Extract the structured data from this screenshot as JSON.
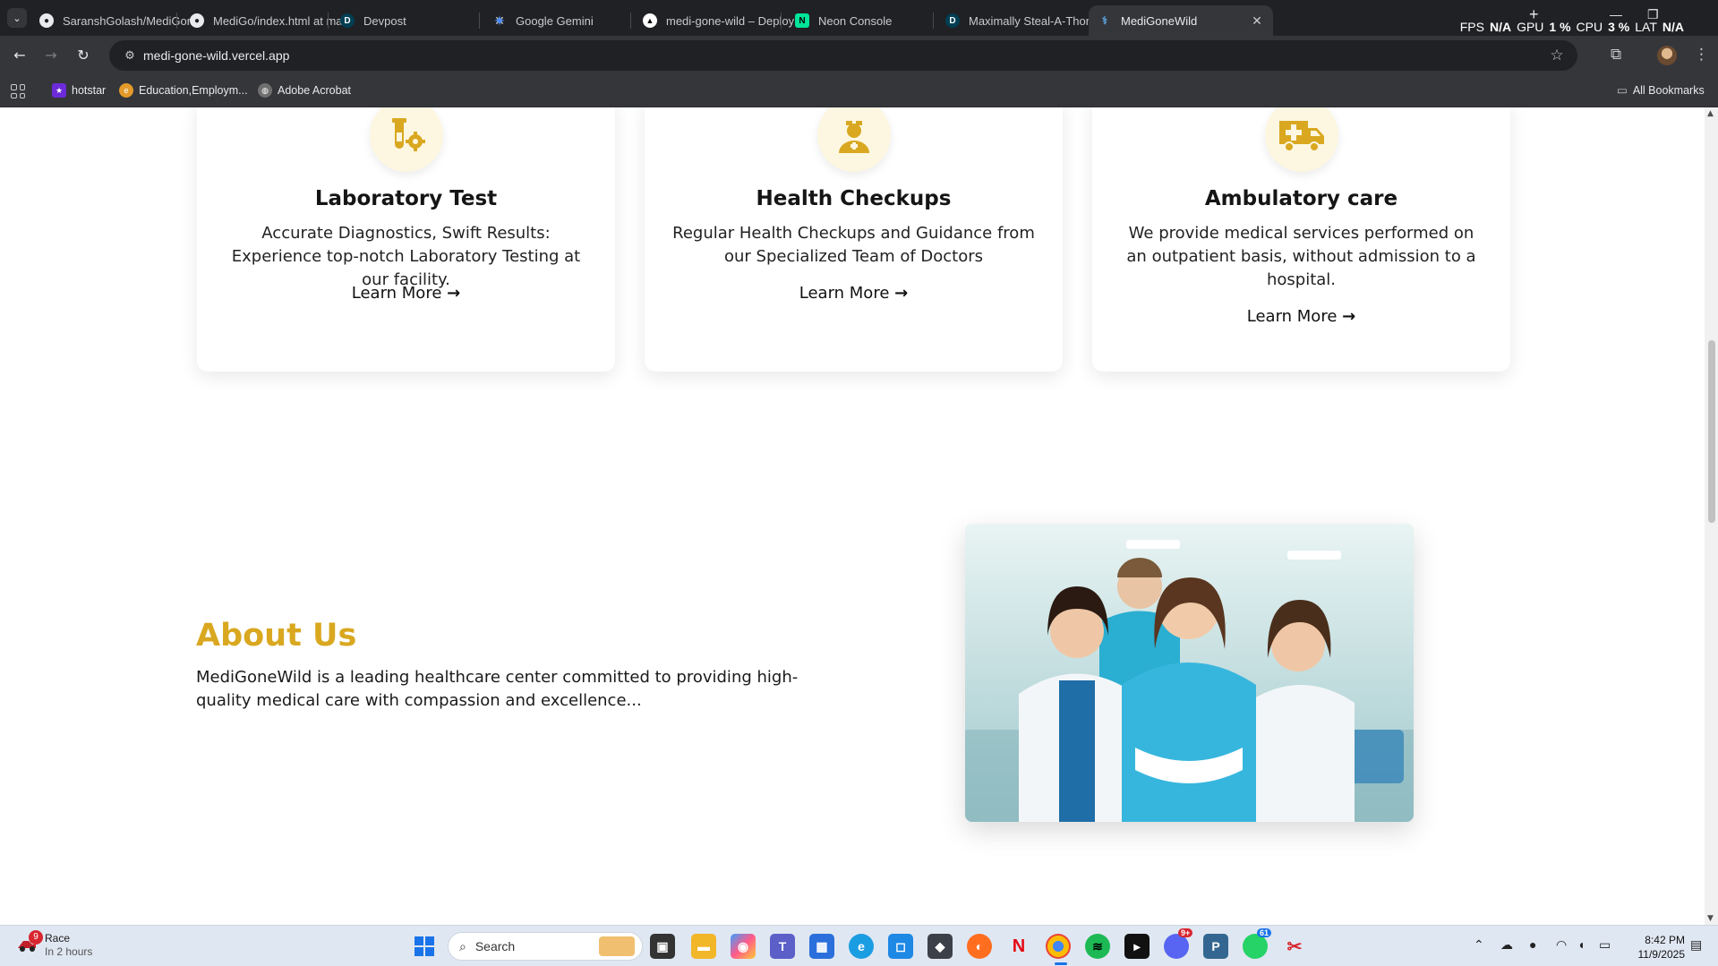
{
  "browser": {
    "tabs": [
      {
        "title": "SaranshGolash/MediGone",
        "icon": "github-icon"
      },
      {
        "title": "MediGo/index.html at ma",
        "icon": "github-icon"
      },
      {
        "title": "Devpost",
        "icon": "devpost-icon"
      },
      {
        "title": "Google Gemini",
        "icon": "gemini-icon"
      },
      {
        "title": "medi-gone-wild – Deploy",
        "icon": "vercel-icon"
      },
      {
        "title": "Neon Console",
        "icon": "neon-icon"
      },
      {
        "title": "Maximally Steal-A-Thon",
        "icon": "devpost-icon"
      },
      {
        "title": "MediGoneWild",
        "icon": "medigonewild-icon",
        "active": true
      }
    ],
    "overlay_stats": {
      "fps_label": "FPS",
      "fps_value": "N/A",
      "gpu_label": "GPU",
      "gpu_value": "1 %",
      "cpu_label": "CPU",
      "cpu_value": "3 %",
      "lat_label": "LAT",
      "lat_value": "N/A"
    },
    "url": "medi-gone-wild.vercel.app",
    "bookmarks": [
      {
        "label": "hotstar",
        "color": "#6b2bd9"
      },
      {
        "label": "Education,Employm...",
        "color": "#e39a2a"
      },
      {
        "label": "Adobe Acrobat",
        "color": "#6f6f6f"
      }
    ],
    "all_bookmarks_label": "All Bookmarks"
  },
  "services": [
    {
      "title": "Laboratory Test",
      "description": "Accurate Diagnostics, Swift Results: Experience top-notch Laboratory Testing at our facility.",
      "link": "Learn More",
      "icon": "lab-icon"
    },
    {
      "title": "Health Checkups",
      "description": "Regular Health Checkups and Guidance from our Specialized Team of Doctors",
      "link": "Learn More",
      "icon": "doctor-icon"
    },
    {
      "title": "Ambulatory care",
      "description": "We provide medical services performed on an outpatient basis, without admission to a hospital.",
      "link": "Learn More",
      "icon": "ambulance-icon"
    }
  ],
  "about": {
    "title": "About Us",
    "text": "MediGoneWild is a leading healthcare center committed to providing high-quality medical care with compassion and excellence..."
  },
  "colors": {
    "accent": "#d9a820",
    "icon_bg": "#fdf7e1"
  },
  "taskbar": {
    "weather_title": "Race",
    "weather_sub": "In 2 hours",
    "weather_badge": "9",
    "search_placeholder": "Search",
    "discord_badge": "9+",
    "whatsapp_badge": "61",
    "time": "8:42 PM",
    "date": "11/9/2025"
  }
}
